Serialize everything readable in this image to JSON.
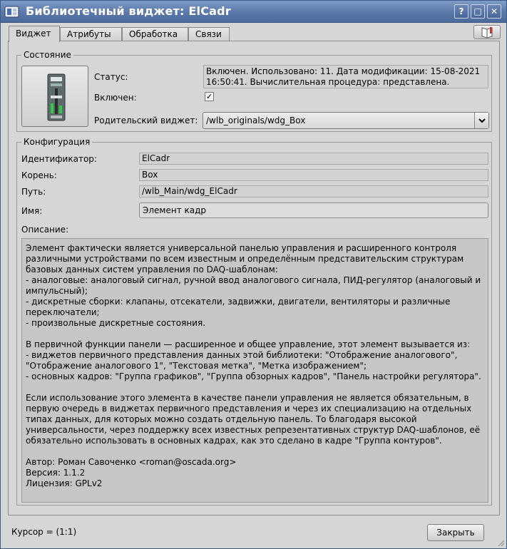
{
  "window": {
    "title": "Библиотечный виджет: ElCadr",
    "buttons": {
      "help": "?",
      "maximize": "□",
      "close": "✕"
    }
  },
  "tabs": [
    {
      "label": "Виджет",
      "active": true
    },
    {
      "label": "Атрибуты",
      "active": false
    },
    {
      "label": "Обработка",
      "active": false
    },
    {
      "label": "Связи",
      "active": false
    }
  ],
  "state": {
    "group_title": "Состояние",
    "status_label": "Статус:",
    "status_text": "Включен. Использовано: 11. Дата модификации: 15-08-2021 16:50:41. Вычислительная процедура: представлена.",
    "enabled_label": "Включен:",
    "enabled_mark": "✓",
    "parent_label": "Родительский виджет:",
    "parent_value": "/wlb_originals/wdg_Box"
  },
  "config": {
    "group_title": "Конфигурация",
    "id_label": "Идентификатор:",
    "id_value": "ElCadr",
    "root_label": "Корень:",
    "root_value": "Box",
    "path_label": "Путь:",
    "path_value": "/wlb_Main/wdg_ElCadr",
    "name_label": "Имя:",
    "name_value": "Элемент кадр",
    "descr_label": "Описание:",
    "descr_text": "Элемент фактически является универсальной панелью управления и расширенного контроля\nразличными устройствами по всем известным и определённым представительским структурам\nбазовых данных систем управления по DAQ-шаблонам:\n- аналоговые: аналоговый сигнал, ручной ввод аналогового сигнала, ПИД-регулятор (аналоговый и\nимпульсный);\n- дискретные сборки: клапаны, отсекатели, задвижки, двигатели, вентиляторы и различные\nпереключатели;\n- произвольные дискретные состояния.\n\nВ первичной функции панели — расширенное и общее управление, этот элемент вызывается из:\n- виджетов первичного представления данных этой библиотеки: \"Отображение аналогового\",\n\"Отображение аналогового 1\", \"Текстовая метка\", \"Метка изображением\";\n- основных кадров: \"Группа графиков\", \"Группа обзорных кадров\", \"Панель настройки регулятора\".\n\nЕсли использование этого элемента в качестве панели управления не является обязательным, в\nпервую очередь в виджетах первичного представления и через их специализацию на отдельных\nтипах данных, для которых можно создать отдельную панель. То благодаря высокой\nуниверсальности, через поддержку всех известных репрезентативных структур DAQ-шаблонов, её\nобязательно использовать в основных кадрах, как это сделано в кадре \"Группа контуров\".\n\nАвтор: Роман Савоченко <roman@oscada.org>\nВерсия: 1.1.2\nЛицензия: GPLv2"
  },
  "footer": {
    "cursor_text": "Курсор = (1:1)",
    "close_label": "Закрыть"
  }
}
